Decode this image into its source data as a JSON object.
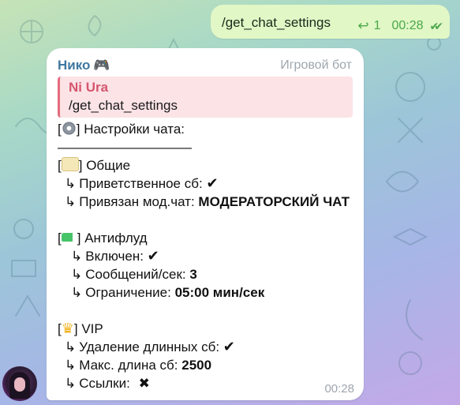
{
  "colors": {
    "accent_green": "#4aa74a",
    "sender_blue": "#3f78a0",
    "quote_pink": "#e56b7d",
    "muted_gray": "#9ea6ad"
  },
  "outgoing": {
    "text": "/get_chat_settings",
    "reply_icon": "reply-arrow-icon",
    "reply_count": "1",
    "time": "00:28",
    "status_icon": "double-check-icon"
  },
  "incoming": {
    "sender": "Нико",
    "sender_emoji": "🎮",
    "badge": "Игровой бот",
    "quote": {
      "author": "Ni Ura",
      "text": "/get_chat_settings"
    },
    "header": "Настройки чата:",
    "divider": "——————————",
    "general": {
      "title": "Общие",
      "welcome_label": "Приветственное сб:",
      "mod_chat_label": "Привязан мод.чат:",
      "mod_chat_value": "МОДЕРАТОРСКИЙ ЧАТ"
    },
    "antiflood": {
      "title": "Антифлуд",
      "enabled_label": "Включен:",
      "rate_label": "Сообщений/сек:",
      "rate_value": "3",
      "limit_label": "Ограничение:",
      "limit_value": "05:00 мин/сек"
    },
    "vip": {
      "title": "VIP",
      "long_msg_label": "Удаление длинных сб:",
      "max_len_label": "Макс. длина сб:",
      "max_len_value": "2500",
      "links_label": "Ссылки:"
    },
    "time": "00:28"
  },
  "glyphs": {
    "arrow": "↳",
    "check": "✔",
    "cross": "✖",
    "open_bracket": "[",
    "close_bracket": "]"
  }
}
